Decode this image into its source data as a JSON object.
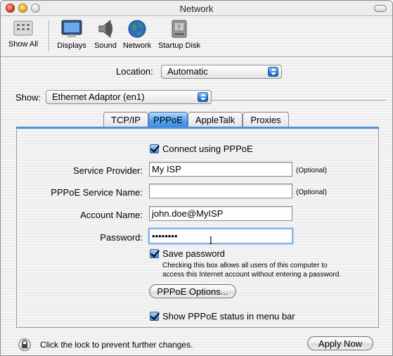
{
  "window": {
    "title": "Network"
  },
  "toolbar": {
    "items": [
      {
        "label": "Show All",
        "icon": "show-all-icon"
      },
      {
        "label": "Displays",
        "icon": "displays-icon"
      },
      {
        "label": "Sound",
        "icon": "sound-icon"
      },
      {
        "label": "Network",
        "icon": "network-icon"
      },
      {
        "label": "Startup Disk",
        "icon": "startup-disk-icon"
      }
    ]
  },
  "location": {
    "label": "Location:",
    "value": "Automatic"
  },
  "show": {
    "label": "Show:",
    "value": "Ethernet Adaptor (en1)"
  },
  "tabs": [
    {
      "label": "TCP/IP",
      "active": false
    },
    {
      "label": "PPPoE",
      "active": true
    },
    {
      "label": "AppleTalk",
      "active": false
    },
    {
      "label": "Proxies",
      "active": false
    }
  ],
  "pppoe": {
    "connect_label": "Connect using PPPoE",
    "connect_checked": true,
    "service_provider_label": "Service Provider:",
    "service_provider_value": "My ISP",
    "service_provider_hint": "(Optional)",
    "service_name_label": "PPPoE Service Name:",
    "service_name_value": "",
    "service_name_hint": "(Optional)",
    "account_name_label": "Account Name:",
    "account_name_value": "john.doe@MyISP",
    "password_label": "Password:",
    "password_value": "••••••••",
    "save_password_label": "Save password",
    "save_password_checked": true,
    "save_password_help_1": "Checking this box allows all users of this computer to",
    "save_password_help_2": "access this Internet account without entering a password.",
    "options_button": "PPPoE Options...",
    "show_status_label": "Show PPPoE status in menu bar",
    "show_status_checked": true
  },
  "footer": {
    "lock_text": "Click the lock to prevent further changes.",
    "apply_button": "Apply Now"
  },
  "colors": {
    "accent": "#3a8be6",
    "tab_active": "#5aa6f1"
  }
}
